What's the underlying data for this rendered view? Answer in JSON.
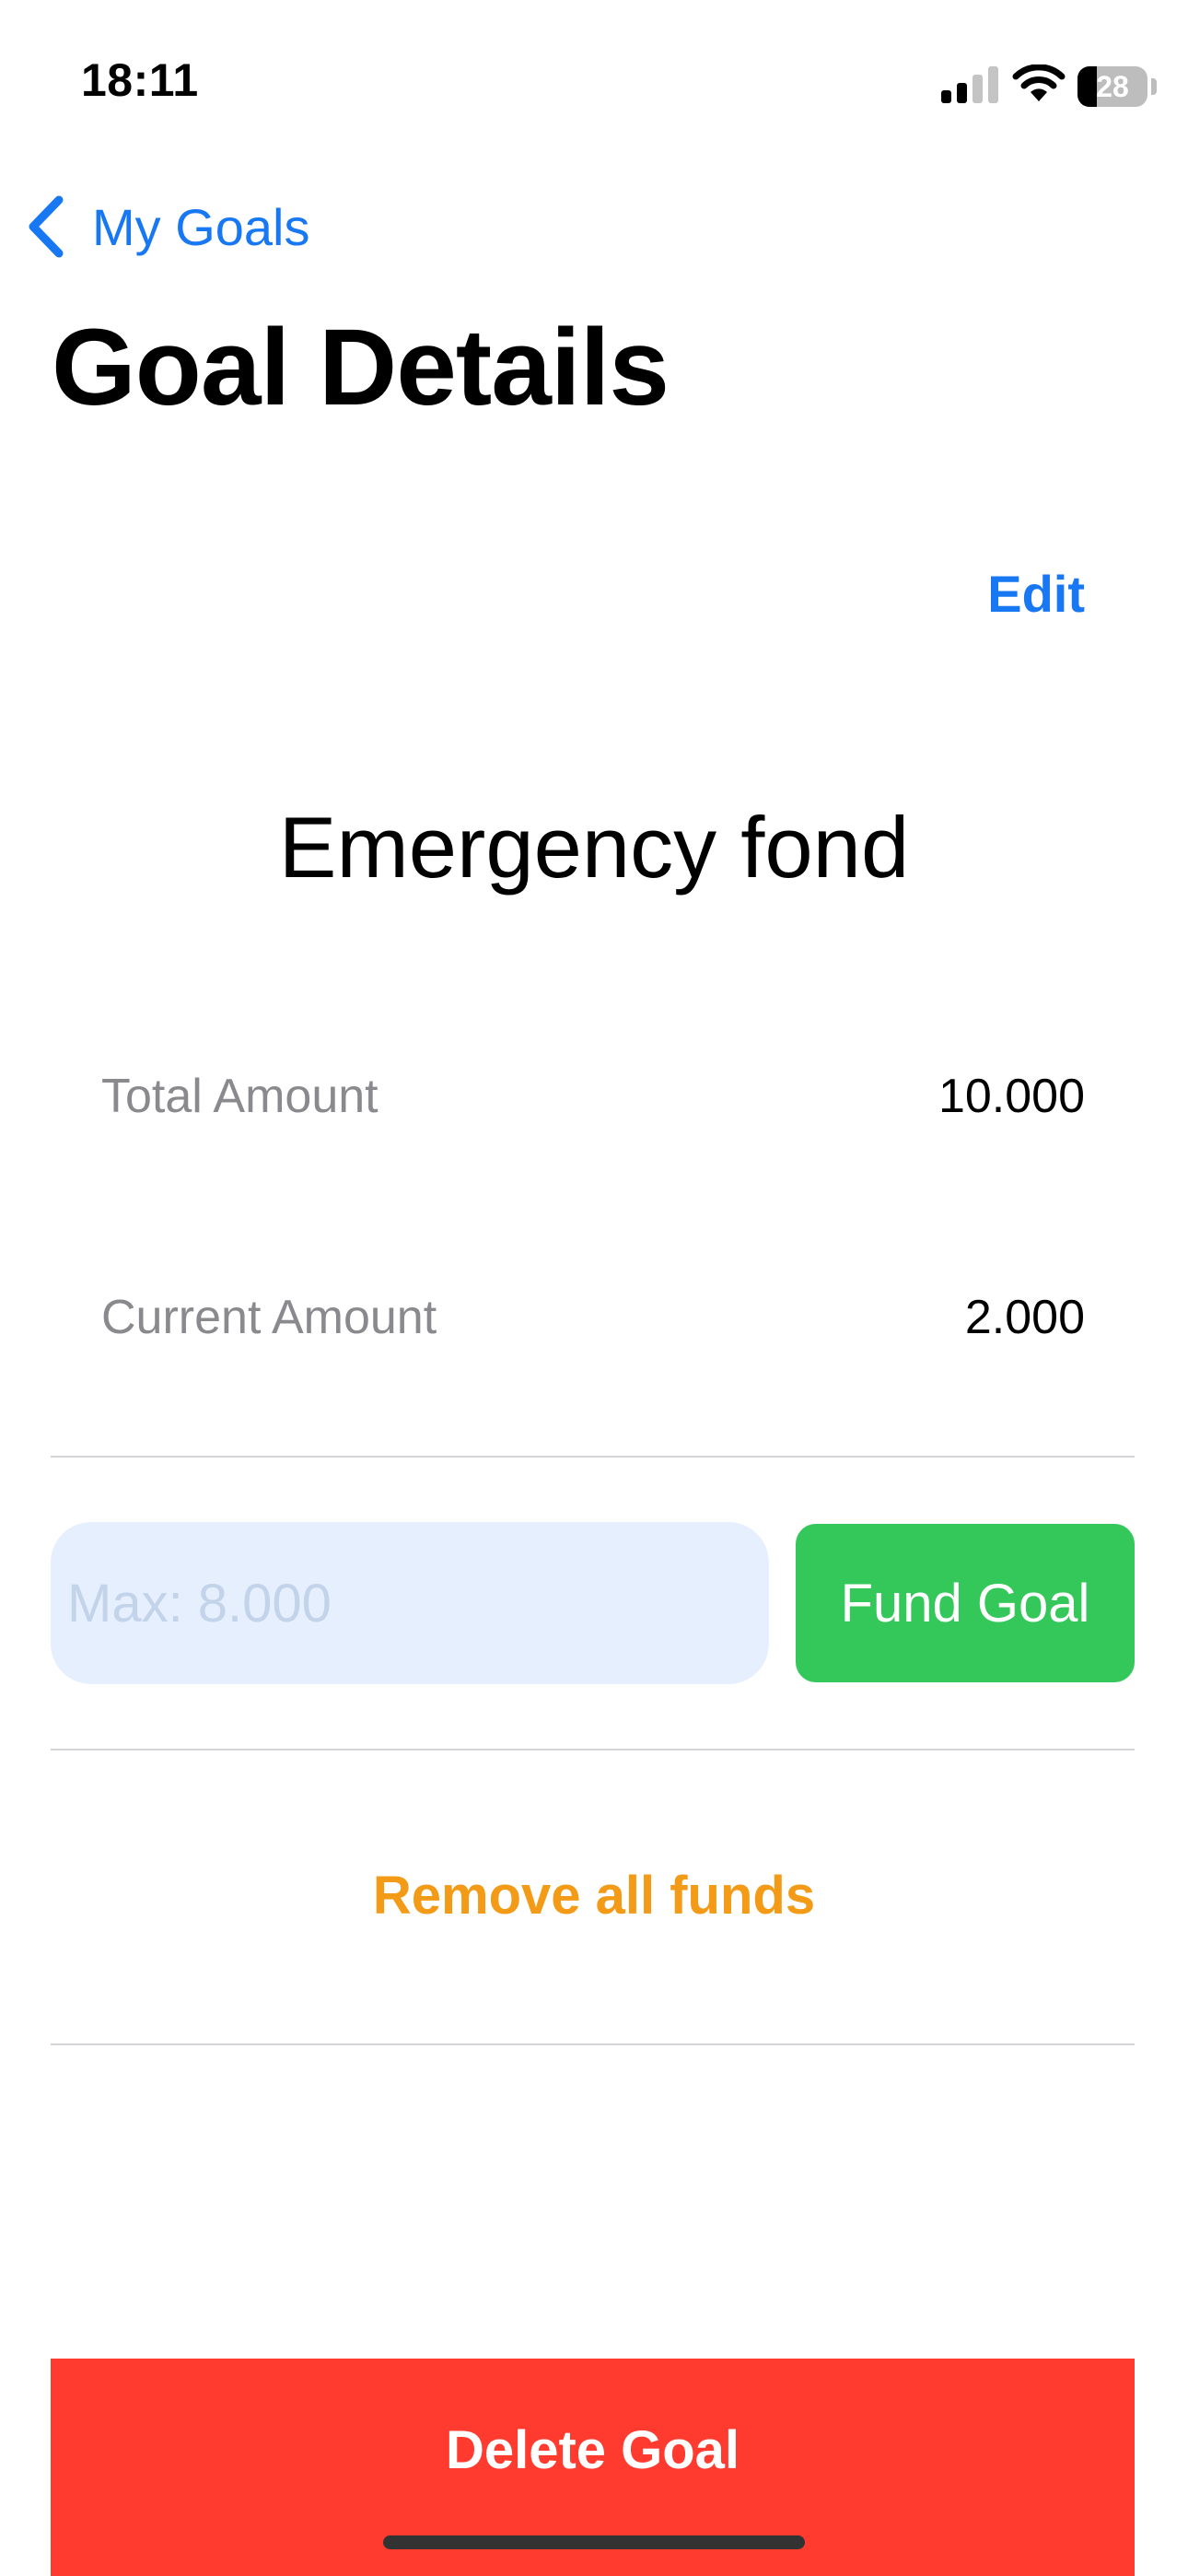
{
  "status_bar": {
    "time": "18:11",
    "battery_level": "28",
    "battery_fraction": 0.28,
    "signal_bars_active": 2,
    "signal_bars_total": 4,
    "icons": [
      "cellular-signal-icon",
      "wifi-icon",
      "battery-icon"
    ]
  },
  "nav": {
    "back_label": "My Goals",
    "back_icon": "chevron-left-icon",
    "title": "Goal Details",
    "edit_label": "Edit"
  },
  "goal": {
    "name": "Emergency fond",
    "total_label": "Total Amount",
    "total_value": "10.000",
    "current_label": "Current Amount",
    "current_value": "2.000"
  },
  "fund": {
    "input_placeholder": "Max: 8.000",
    "input_value": "",
    "button_label": "Fund Goal"
  },
  "actions": {
    "remove_funds_label": "Remove all funds",
    "delete_label": "Delete Goal"
  },
  "colors": {
    "accent_blue": "#1877f2",
    "fund_green": "#34c759",
    "remove_orange": "#f39a16",
    "delete_red": "#ff3b30",
    "label_gray": "#8a8a8e",
    "input_bg": "#e5effd"
  }
}
